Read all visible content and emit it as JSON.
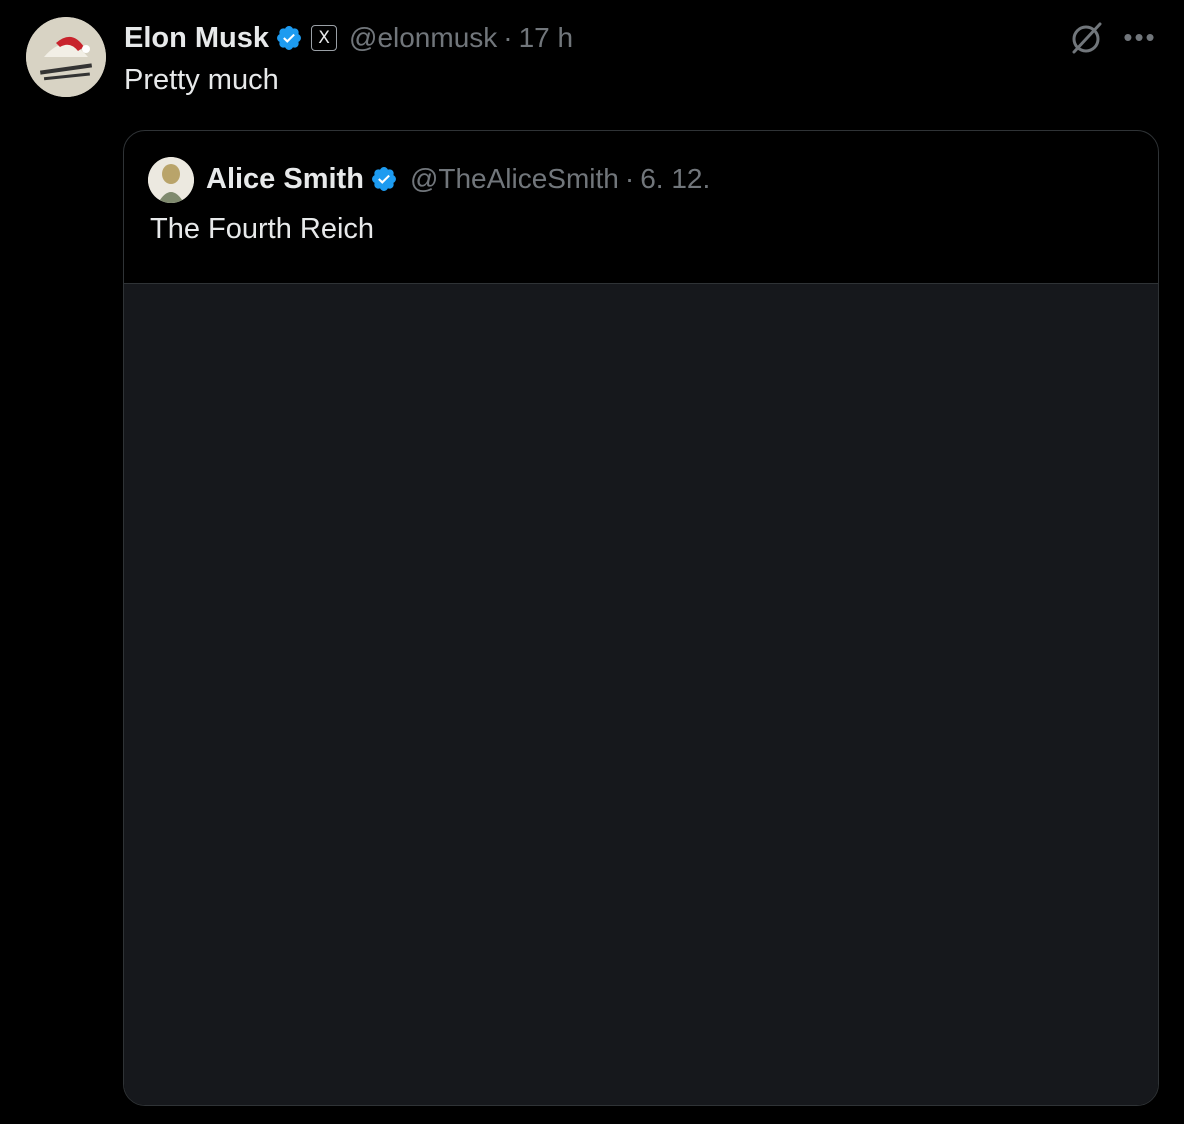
{
  "post": {
    "author_name": "Elon Musk",
    "affiliate_badge": "X",
    "handle": "@elonmusk",
    "separator": "·",
    "time": "17 h",
    "text": "Pretty much",
    "verified": true
  },
  "quoted_post": {
    "author_name": "Alice Smith",
    "handle": "@TheAliceSmith",
    "separator": "·",
    "date": "6. 12.",
    "text": "The Fourth Reich",
    "verified": true,
    "has_media": true
  },
  "icons": {
    "verified": "verified-badge-icon",
    "grok": "grok-icon",
    "more": "more-options-icon"
  },
  "colors": {
    "background": "#000000",
    "primary_text": "#e7e9ea",
    "secondary_text": "#71767b",
    "verified_blue": "#1d9bf0",
    "border": "#2f3336"
  }
}
